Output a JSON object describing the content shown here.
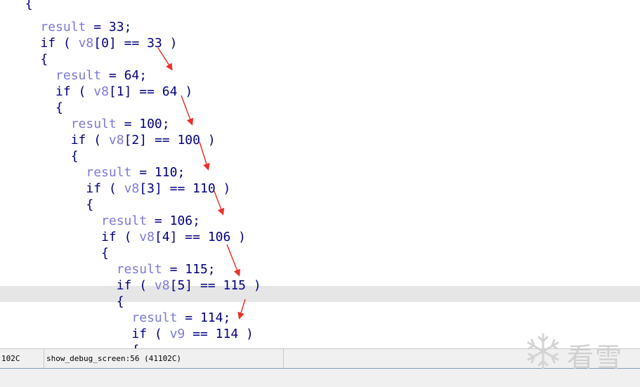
{
  "code_lines": [
    {
      "indent": "  ",
      "tokens": [
        {
          "t": "punc",
          "v": "{"
        }
      ]
    },
    {
      "indent": "    ",
      "tokens": [
        {
          "t": "var",
          "v": "result"
        },
        {
          "t": "op",
          "v": " = "
        },
        {
          "t": "num",
          "v": "33"
        },
        {
          "t": "punc",
          "v": ";"
        }
      ]
    },
    {
      "indent": "    ",
      "tokens": [
        {
          "t": "kw",
          "v": "if"
        },
        {
          "t": "punc",
          "v": " ( "
        },
        {
          "t": "var",
          "v": "v8"
        },
        {
          "t": "punc",
          "v": "[0]"
        },
        {
          "t": "op",
          "v": " == "
        },
        {
          "t": "num",
          "v": "33"
        },
        {
          "t": "punc",
          "v": " )"
        }
      ]
    },
    {
      "indent": "    ",
      "tokens": [
        {
          "t": "punc",
          "v": "{"
        }
      ]
    },
    {
      "indent": "      ",
      "tokens": [
        {
          "t": "var",
          "v": "result"
        },
        {
          "t": "op",
          "v": " = "
        },
        {
          "t": "num",
          "v": "64"
        },
        {
          "t": "punc",
          "v": ";"
        }
      ]
    },
    {
      "indent": "      ",
      "tokens": [
        {
          "t": "kw",
          "v": "if"
        },
        {
          "t": "punc",
          "v": " ( "
        },
        {
          "t": "var",
          "v": "v8"
        },
        {
          "t": "punc",
          "v": "[1]"
        },
        {
          "t": "op",
          "v": " == "
        },
        {
          "t": "num",
          "v": "64"
        },
        {
          "t": "punc",
          "v": " )"
        }
      ]
    },
    {
      "indent": "      ",
      "tokens": [
        {
          "t": "punc",
          "v": "{"
        }
      ]
    },
    {
      "indent": "        ",
      "tokens": [
        {
          "t": "var",
          "v": "result"
        },
        {
          "t": "op",
          "v": " = "
        },
        {
          "t": "num",
          "v": "100"
        },
        {
          "t": "punc",
          "v": ";"
        }
      ]
    },
    {
      "indent": "        ",
      "tokens": [
        {
          "t": "kw",
          "v": "if"
        },
        {
          "t": "punc",
          "v": " ( "
        },
        {
          "t": "var",
          "v": "v8"
        },
        {
          "t": "punc",
          "v": "[2]"
        },
        {
          "t": "op",
          "v": " == "
        },
        {
          "t": "num",
          "v": "100"
        },
        {
          "t": "punc",
          "v": " )"
        }
      ]
    },
    {
      "indent": "        ",
      "tokens": [
        {
          "t": "punc",
          "v": "{"
        }
      ]
    },
    {
      "indent": "          ",
      "tokens": [
        {
          "t": "var",
          "v": "result"
        },
        {
          "t": "op",
          "v": " = "
        },
        {
          "t": "num",
          "v": "110"
        },
        {
          "t": "punc",
          "v": ";"
        }
      ]
    },
    {
      "indent": "          ",
      "tokens": [
        {
          "t": "kw",
          "v": "if"
        },
        {
          "t": "punc",
          "v": " ( "
        },
        {
          "t": "var",
          "v": "v8"
        },
        {
          "t": "punc",
          "v": "[3]"
        },
        {
          "t": "op",
          "v": " == "
        },
        {
          "t": "num",
          "v": "110"
        },
        {
          "t": "punc",
          "v": " )"
        }
      ]
    },
    {
      "indent": "          ",
      "tokens": [
        {
          "t": "punc",
          "v": "{"
        }
      ]
    },
    {
      "indent": "            ",
      "tokens": [
        {
          "t": "var",
          "v": "result"
        },
        {
          "t": "op",
          "v": " = "
        },
        {
          "t": "num",
          "v": "106"
        },
        {
          "t": "punc",
          "v": ";"
        }
      ]
    },
    {
      "indent": "            ",
      "tokens": [
        {
          "t": "kw",
          "v": "if"
        },
        {
          "t": "punc",
          "v": " ( "
        },
        {
          "t": "var",
          "v": "v8"
        },
        {
          "t": "punc",
          "v": "[4]"
        },
        {
          "t": "op",
          "v": " == "
        },
        {
          "t": "num",
          "v": "106"
        },
        {
          "t": "punc",
          "v": " )"
        }
      ]
    },
    {
      "indent": "            ",
      "tokens": [
        {
          "t": "punc",
          "v": "{"
        }
      ]
    },
    {
      "indent": "              ",
      "tokens": [
        {
          "t": "var",
          "v": "result"
        },
        {
          "t": "op",
          "v": " = "
        },
        {
          "t": "num",
          "v": "115"
        },
        {
          "t": "punc",
          "v": ";"
        }
      ]
    },
    {
      "indent": "              ",
      "tokens": [
        {
          "t": "kw",
          "v": "if"
        },
        {
          "t": "punc",
          "v": " ( "
        },
        {
          "t": "var",
          "v": "v8"
        },
        {
          "t": "punc",
          "v": "[5]"
        },
        {
          "t": "op",
          "v": " == "
        },
        {
          "t": "num",
          "v": "115"
        },
        {
          "t": "punc",
          "v": " )"
        }
      ]
    },
    {
      "indent": "              ",
      "tokens": [
        {
          "t": "punc",
          "v": "{"
        }
      ]
    },
    {
      "indent": "                ",
      "tokens": [
        {
          "t": "var",
          "v": "result"
        },
        {
          "t": "op",
          "v": " = "
        },
        {
          "t": "num",
          "v": "114"
        },
        {
          "t": "punc",
          "v": ";"
        }
      ]
    },
    {
      "indent": "                ",
      "tokens": [
        {
          "t": "kw",
          "v": "if"
        },
        {
          "t": "punc",
          "v": " ( "
        },
        {
          "t": "var",
          "v": "v9"
        },
        {
          "t": "op",
          "v": " == "
        },
        {
          "t": "num",
          "v": "114"
        },
        {
          "t": "punc",
          "v": " )"
        }
      ]
    },
    {
      "indent": "                ",
      "tokens": [
        {
          "t": "punc",
          "v": "{"
        }
      ]
    }
  ],
  "highlighted_line_index": 18,
  "status": {
    "address": "102C",
    "location": "show_debug_screen:56 (41102C)"
  },
  "watermark": {
    "text": "看雪",
    "icon": "snowflake-icon"
  },
  "colors": {
    "keyword": "#000080",
    "variable": "#7b7bd6",
    "arrow": "#e8332a",
    "highlight": "#e6e6e6"
  }
}
